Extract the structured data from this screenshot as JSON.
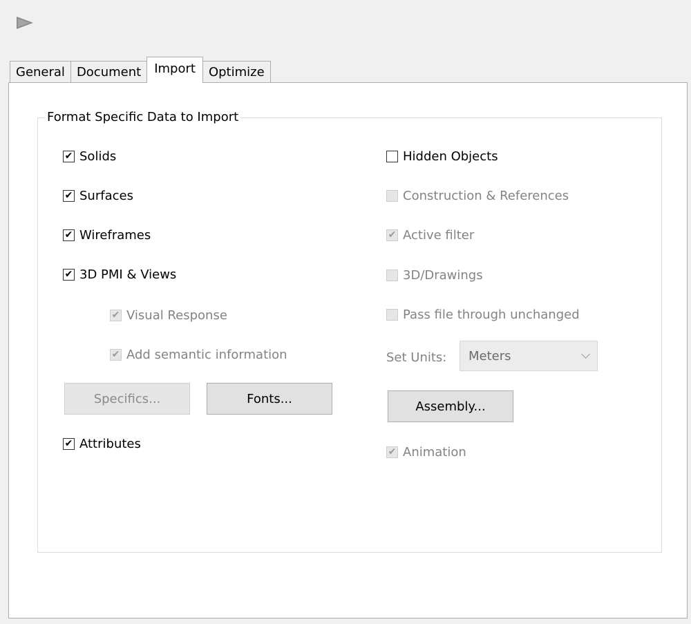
{
  "tabs": [
    "General",
    "Document",
    "Import",
    "Optimize"
  ],
  "active_tab": "Import",
  "group_title": "Format Specific Data to Import",
  "left_checks": {
    "solids": {
      "label": "Solids",
      "checked": true,
      "enabled": true
    },
    "surfaces": {
      "label": "Surfaces",
      "checked": true,
      "enabled": true
    },
    "wireframes": {
      "label": "Wireframes",
      "checked": true,
      "enabled": true
    },
    "pmi": {
      "label": "3D PMI & Views",
      "checked": true,
      "enabled": true
    },
    "visual_response": {
      "label": "Visual Response",
      "checked": true,
      "enabled": false
    },
    "semantic": {
      "label": "Add semantic information",
      "checked": true,
      "enabled": false
    },
    "attributes": {
      "label": "Attributes",
      "checked": true,
      "enabled": true
    }
  },
  "right_checks": {
    "hidden": {
      "label": "Hidden Objects",
      "checked": false,
      "enabled": true
    },
    "construction": {
      "label": "Construction & References",
      "checked": false,
      "enabled": false
    },
    "active_filter": {
      "label": "Active filter",
      "checked": true,
      "enabled": false
    },
    "drawings": {
      "label": "3D/Drawings",
      "checked": false,
      "enabled": false
    },
    "pass_file": {
      "label": "Pass file through unchanged",
      "checked": false,
      "enabled": false
    },
    "animation": {
      "label": "Animation",
      "checked": true,
      "enabled": false
    }
  },
  "buttons": {
    "specifics": "Specifics...",
    "fonts": "Fonts...",
    "assembly": "Assembly..."
  },
  "units": {
    "label": "Set Units:",
    "value": "Meters"
  },
  "icons": {
    "play": "play-arrow-icon",
    "check": "checkmark-icon",
    "dropdown": "chevron-down-icon"
  }
}
